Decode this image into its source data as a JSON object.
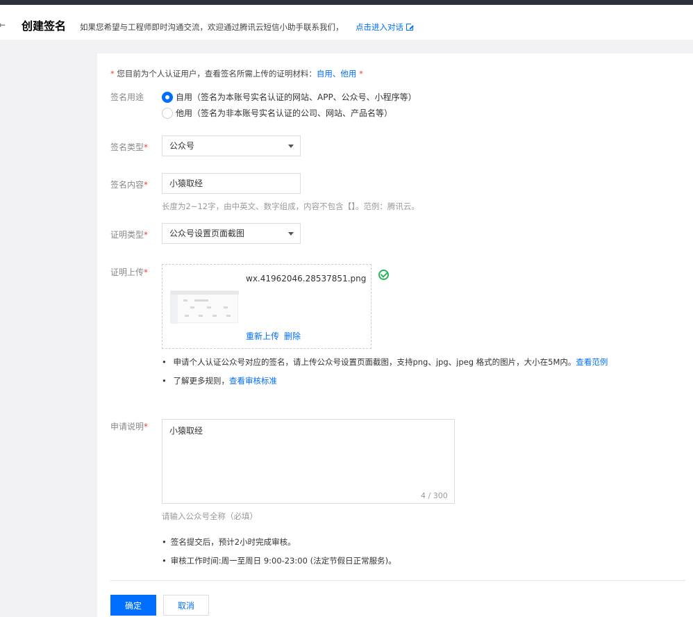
{
  "header": {
    "back_icon": "back-arrow-icon",
    "title": "创建签名",
    "tip": "如果您希望与工程师即时沟通交流，欢迎通过腾讯云短信小助手联系我们，",
    "link": "点击进入对话"
  },
  "notice": {
    "star": "*",
    "text": "您目前为个人认证用户，查看签名所需上传的证明材料：",
    "link": "自用、他用",
    "trail_star": "*"
  },
  "form": {
    "usage": {
      "label": "签名用途",
      "options": [
        {
          "label": "自用（签名为本账号实名认证的网站、APP、公众号、小程序等）",
          "checked": true
        },
        {
          "label": "他用（签名为非本账号实名认证的公司、网站、产品名等）",
          "checked": false
        }
      ]
    },
    "type": {
      "label": "签名类型",
      "required": "*",
      "value": "公众号"
    },
    "content": {
      "label": "签名内容",
      "required": "*",
      "value": "小猿取经",
      "hint": "长度为2~12字，由中英文、数字组成，内容不包含【】。范例：腾讯云。"
    },
    "proof_type": {
      "label": "证明类型",
      "required": "*",
      "value": "公众号设置页面截图"
    },
    "proof_upload": {
      "label": "证明上传",
      "required": "*",
      "file_name": "wx.41962046.28537851.png",
      "reupload": "重新上传",
      "delete": "删除",
      "bullets": [
        {
          "text": "申请个人认证公众号对应的签名，请上传公众号设置页面截图，支持png、jpg、jpeg 格式的图片，大小在5M内。",
          "link": "查看范例"
        },
        {
          "text": "了解更多规则，",
          "link": "查看审核标准"
        }
      ]
    },
    "description": {
      "label": "申请说明",
      "required": "*",
      "value": "小猿取经",
      "counter": "4 / 300",
      "hint": "请输入公众号全称（必填）"
    },
    "notes": [
      "签名提交后，预计2小时完成审核。",
      "审核工作时间:周一至周日 9:00-23:00 (法定节假日正常服务)。"
    ]
  },
  "actions": {
    "confirm": "确定",
    "cancel": "取消"
  },
  "colors": {
    "accent": "#006eff",
    "required": "#e54545",
    "success": "#29b35a"
  }
}
